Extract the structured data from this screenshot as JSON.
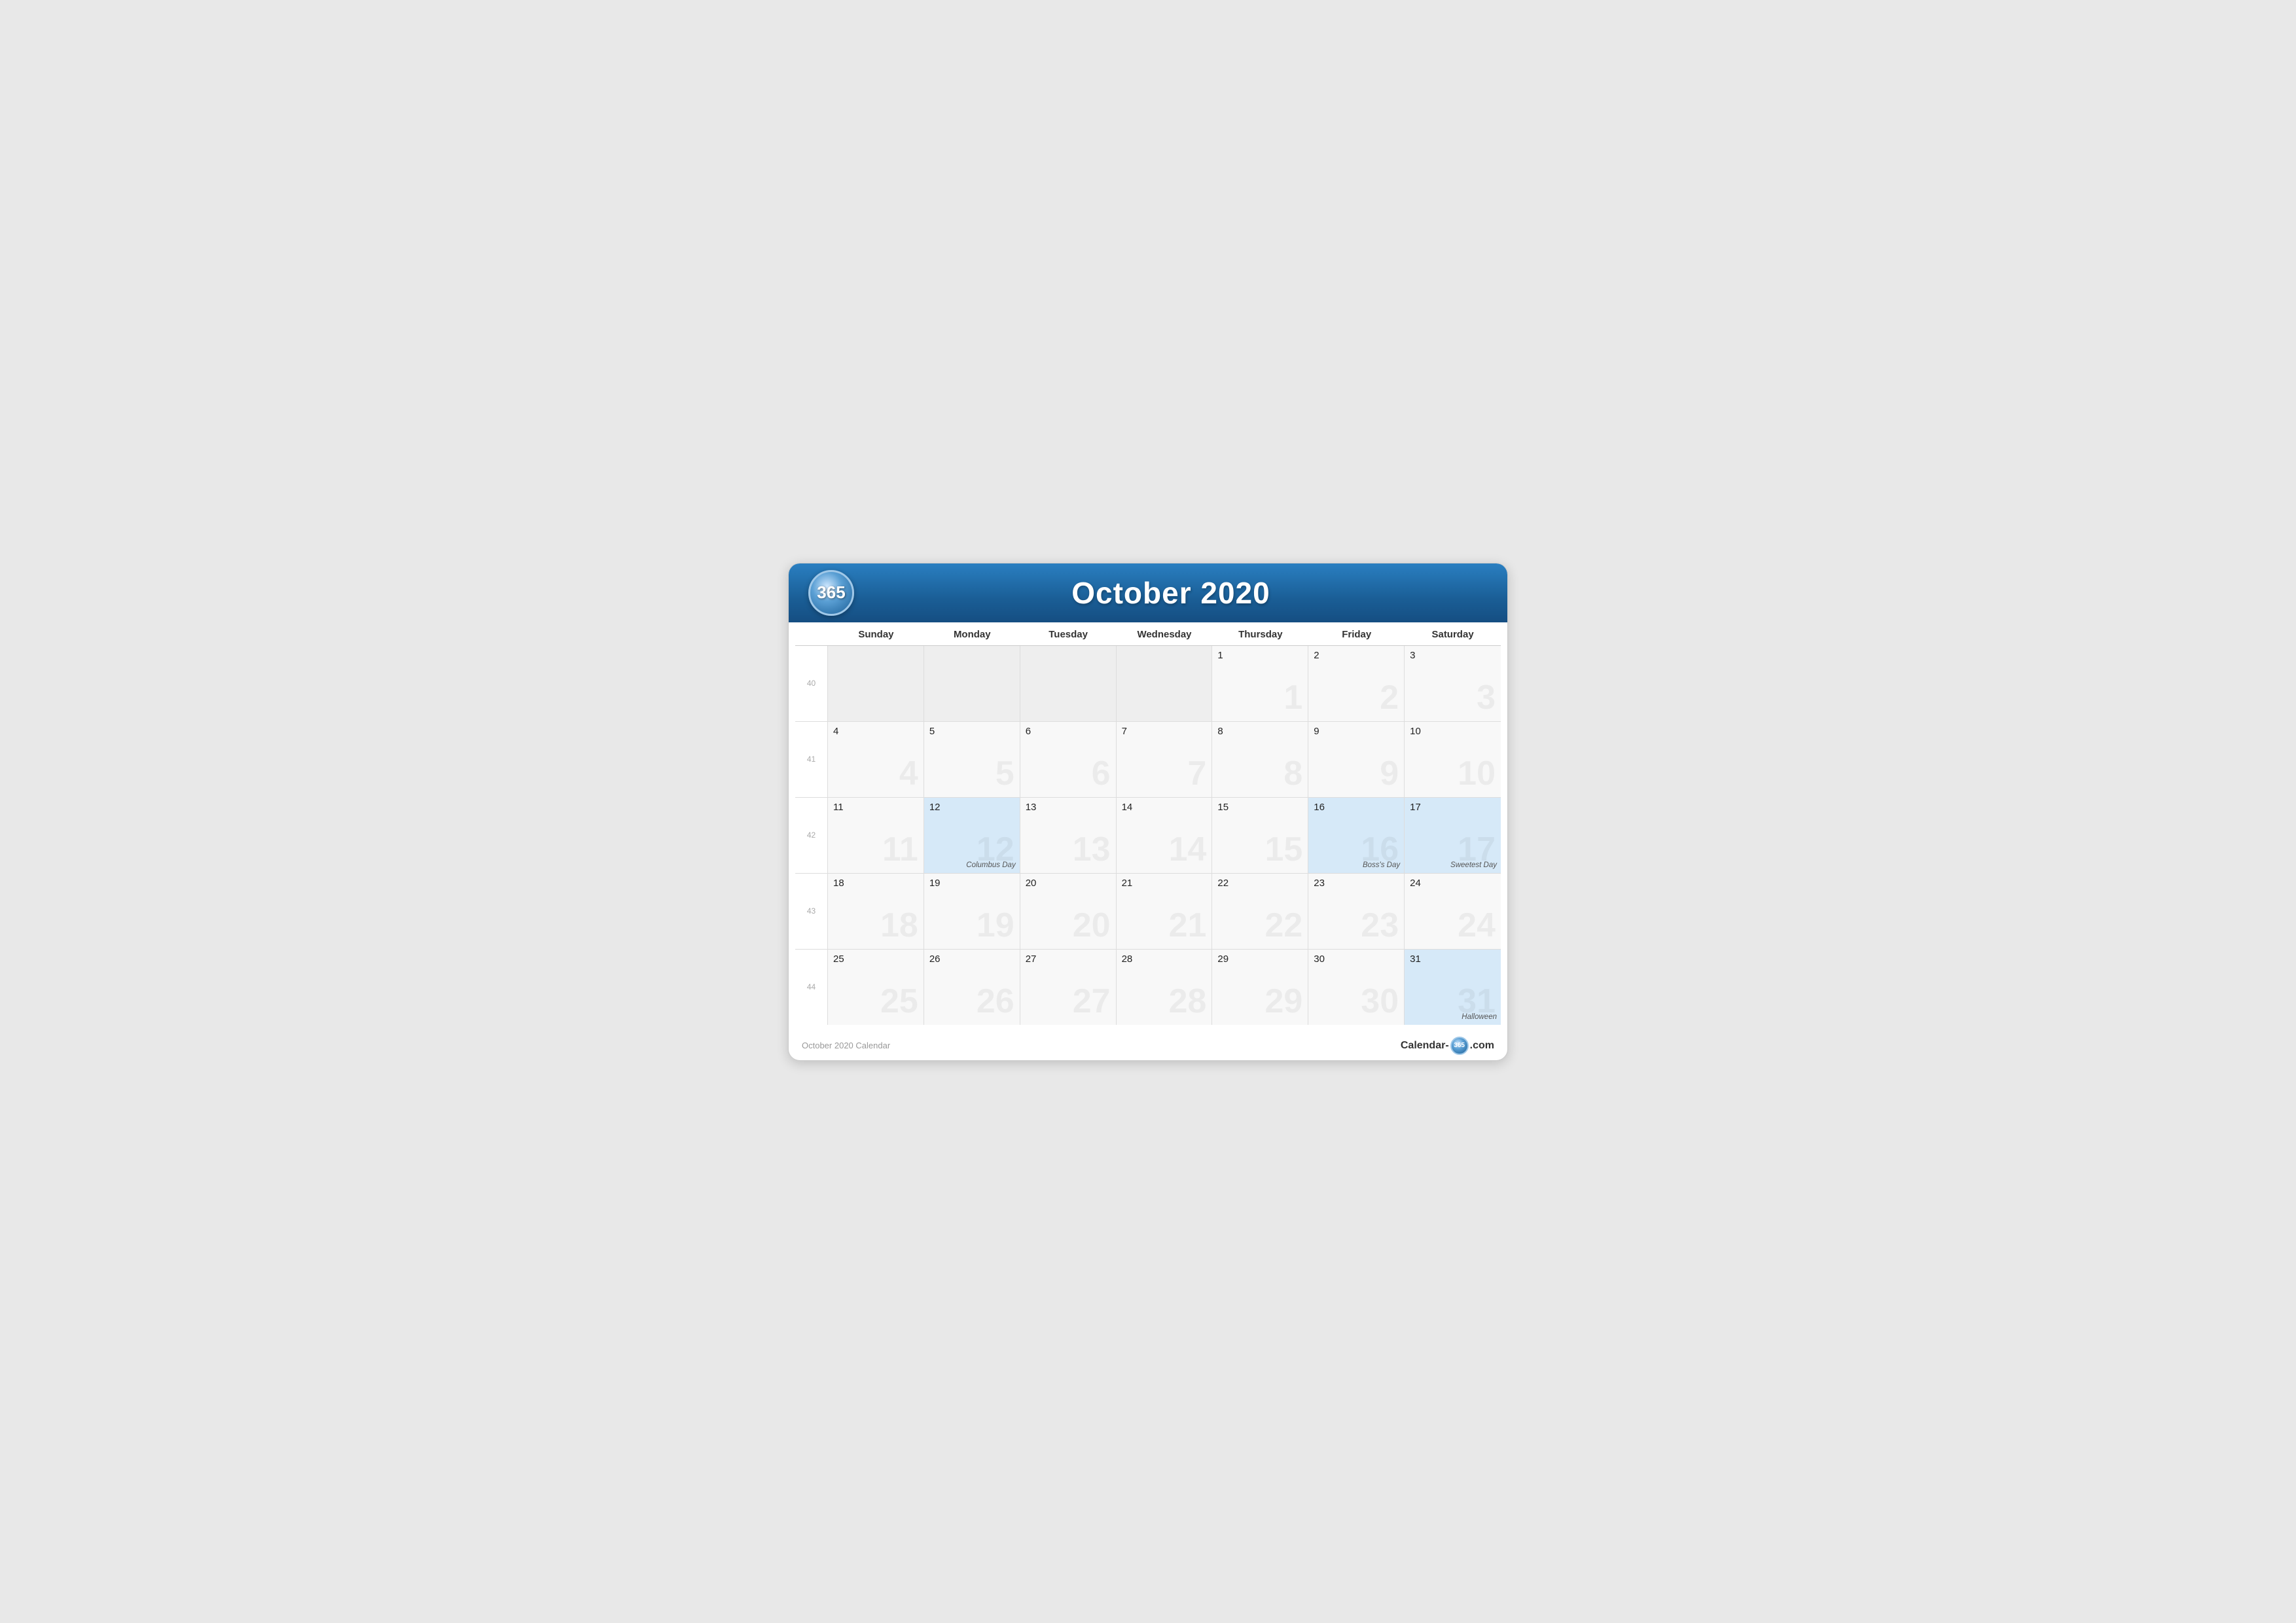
{
  "header": {
    "logo_text": "365",
    "title": "October 2020"
  },
  "days_of_week": [
    "Sunday",
    "Monday",
    "Tuesday",
    "Wednesday",
    "Thursday",
    "Friday",
    "Saturday"
  ],
  "weeks": [
    {
      "week_number": "40",
      "days": [
        {
          "date": "",
          "month": "out",
          "watermark": "",
          "holiday": ""
        },
        {
          "date": "",
          "month": "out",
          "watermark": "",
          "holiday": ""
        },
        {
          "date": "",
          "month": "out",
          "watermark": "",
          "holiday": ""
        },
        {
          "date": "",
          "month": "out",
          "watermark": "",
          "holiday": ""
        },
        {
          "date": "1",
          "month": "current",
          "watermark": "1",
          "holiday": ""
        },
        {
          "date": "2",
          "month": "current",
          "watermark": "2",
          "holiday": ""
        },
        {
          "date": "3",
          "month": "current",
          "watermark": "3",
          "holiday": ""
        }
      ]
    },
    {
      "week_number": "41",
      "days": [
        {
          "date": "4",
          "month": "current",
          "watermark": "4",
          "holiday": ""
        },
        {
          "date": "5",
          "month": "current",
          "watermark": "5",
          "holiday": ""
        },
        {
          "date": "6",
          "month": "current",
          "watermark": "6",
          "holiday": ""
        },
        {
          "date": "7",
          "month": "current",
          "watermark": "7",
          "holiday": ""
        },
        {
          "date": "8",
          "month": "current",
          "watermark": "8",
          "holiday": ""
        },
        {
          "date": "9",
          "month": "current",
          "watermark": "9",
          "holiday": ""
        },
        {
          "date": "10",
          "month": "current",
          "watermark": "10",
          "holiday": ""
        }
      ]
    },
    {
      "week_number": "42",
      "days": [
        {
          "date": "11",
          "month": "current",
          "watermark": "11",
          "holiday": ""
        },
        {
          "date": "12",
          "month": "highlight",
          "watermark": "12",
          "holiday": "Columbus Day"
        },
        {
          "date": "13",
          "month": "current",
          "watermark": "13",
          "holiday": ""
        },
        {
          "date": "14",
          "month": "current",
          "watermark": "14",
          "holiday": ""
        },
        {
          "date": "15",
          "month": "current",
          "watermark": "15",
          "holiday": ""
        },
        {
          "date": "16",
          "month": "highlight",
          "watermark": "16",
          "holiday": "Boss's Day"
        },
        {
          "date": "17",
          "month": "highlight",
          "watermark": "17",
          "holiday": "Sweetest Day"
        }
      ]
    },
    {
      "week_number": "43",
      "days": [
        {
          "date": "18",
          "month": "current",
          "watermark": "18",
          "holiday": ""
        },
        {
          "date": "19",
          "month": "current",
          "watermark": "19",
          "holiday": ""
        },
        {
          "date": "20",
          "month": "current",
          "watermark": "20",
          "holiday": ""
        },
        {
          "date": "21",
          "month": "current",
          "watermark": "21",
          "holiday": ""
        },
        {
          "date": "22",
          "month": "current",
          "watermark": "22",
          "holiday": ""
        },
        {
          "date": "23",
          "month": "current",
          "watermark": "23",
          "holiday": ""
        },
        {
          "date": "24",
          "month": "current",
          "watermark": "24",
          "holiday": ""
        }
      ]
    },
    {
      "week_number": "44",
      "days": [
        {
          "date": "25",
          "month": "current",
          "watermark": "25",
          "holiday": ""
        },
        {
          "date": "26",
          "month": "current",
          "watermark": "26",
          "holiday": ""
        },
        {
          "date": "27",
          "month": "current",
          "watermark": "27",
          "holiday": ""
        },
        {
          "date": "28",
          "month": "current",
          "watermark": "28",
          "holiday": ""
        },
        {
          "date": "29",
          "month": "current",
          "watermark": "29",
          "holiday": ""
        },
        {
          "date": "30",
          "month": "current",
          "watermark": "30",
          "holiday": ""
        },
        {
          "date": "31",
          "month": "highlight",
          "watermark": "31",
          "holiday": "Halloween"
        }
      ]
    }
  ],
  "footer": {
    "left_text": "October 2020 Calendar",
    "right_text_pre": "Calendar-",
    "right_logo": "365",
    "right_text_post": ".com"
  }
}
